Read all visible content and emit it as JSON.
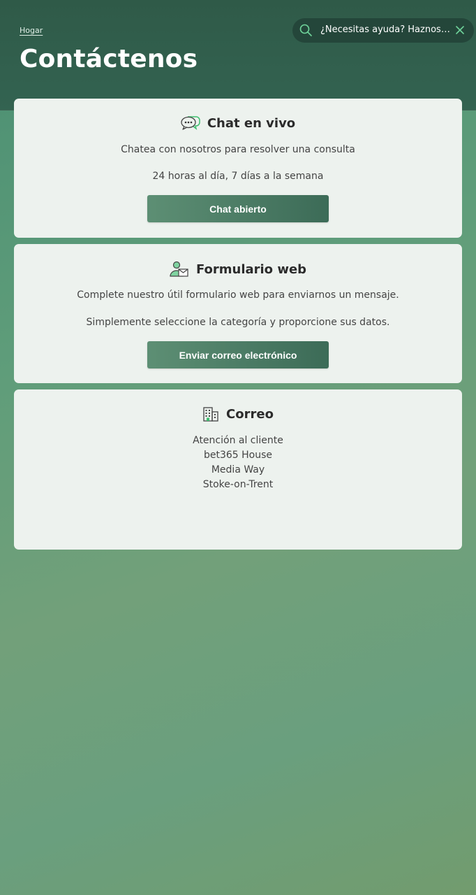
{
  "header": {
    "breadcrumb": "Hogar",
    "title": "Contáctenos"
  },
  "help": {
    "text": "¿Necesitas ayuda? Haznos una pregunta",
    "search_icon": "search-icon",
    "close_icon": "close-icon"
  },
  "chat": {
    "icon": "chat-bubble-icon",
    "title": "Chat en vivo",
    "line1": "Chatea con nosotros para resolver una consulta",
    "line2": "24 horas al día, 7 días a la semana",
    "button": "Chat abierto"
  },
  "form": {
    "icon": "user-mail-icon",
    "title": "Formulario web",
    "line1": "Complete nuestro útil formulario web para enviarnos un mensaje.",
    "line2": "Simplemente seleccione la categoría y proporcione sus datos.",
    "button": "Enviar correo electrónico"
  },
  "mail": {
    "icon": "building-icon",
    "title": "Correo",
    "address": [
      "Atención al cliente",
      "bet365 House",
      "Media Way",
      "Stoke-on-Trent"
    ]
  },
  "colors": {
    "accent": "#4d7d66",
    "icon_green": "#3fbf6f"
  }
}
